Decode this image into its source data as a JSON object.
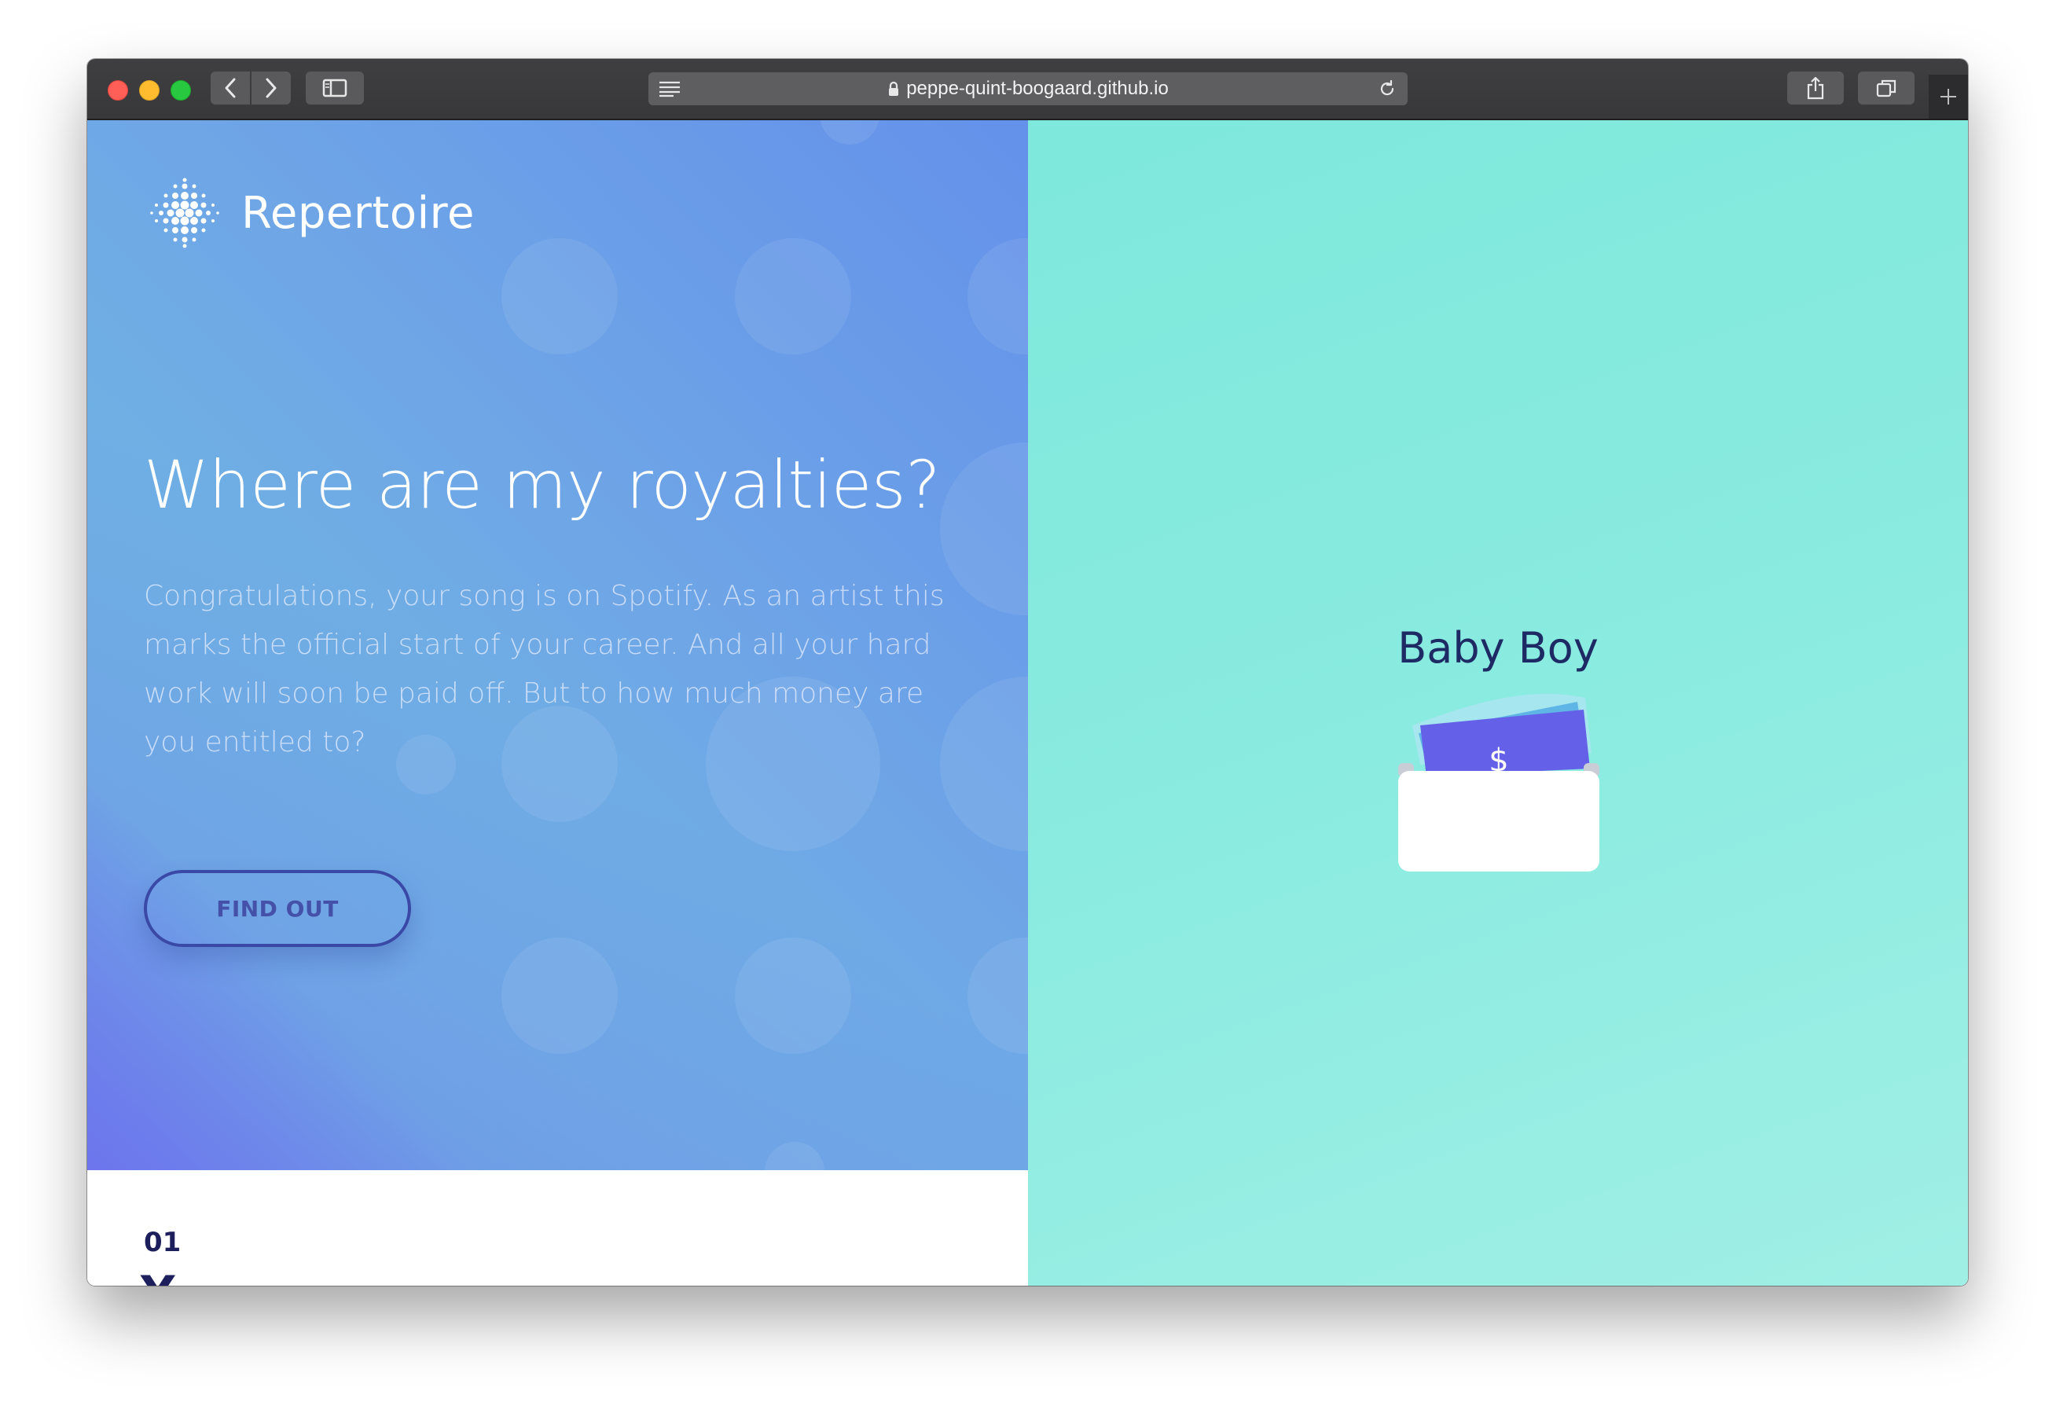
{
  "browser": {
    "url": "peppe-quint-boogaard.github.io",
    "icons": [
      "back-icon",
      "forward-icon",
      "sidebar-icon",
      "reader-icon",
      "lock-icon",
      "reload-icon",
      "share-icon",
      "tabs-icon",
      "plus-icon"
    ]
  },
  "hero": {
    "logo_text": "Repertoire",
    "headline": "Where are my royalties?",
    "body": "Congratulations, your song is on Spotify. As an artist this marks the official start of your career. And all your hard work will soon be paid off. But to how much money are you entitled to?",
    "cta_label": "FIND OUT"
  },
  "section": {
    "number": "01",
    "title_peek": "Y"
  },
  "song": {
    "title": "Baby Boy",
    "currency_symbol": "$"
  },
  "colors": {
    "hero_blue": "#6b9fe8",
    "hero_purple": "#6b6ee9",
    "mint": "#86eadf",
    "navy_text": "#1d2a63",
    "button_border": "#3b49a6",
    "bill_purple": "#6461e8",
    "bill_back": "#5fb6e6"
  }
}
